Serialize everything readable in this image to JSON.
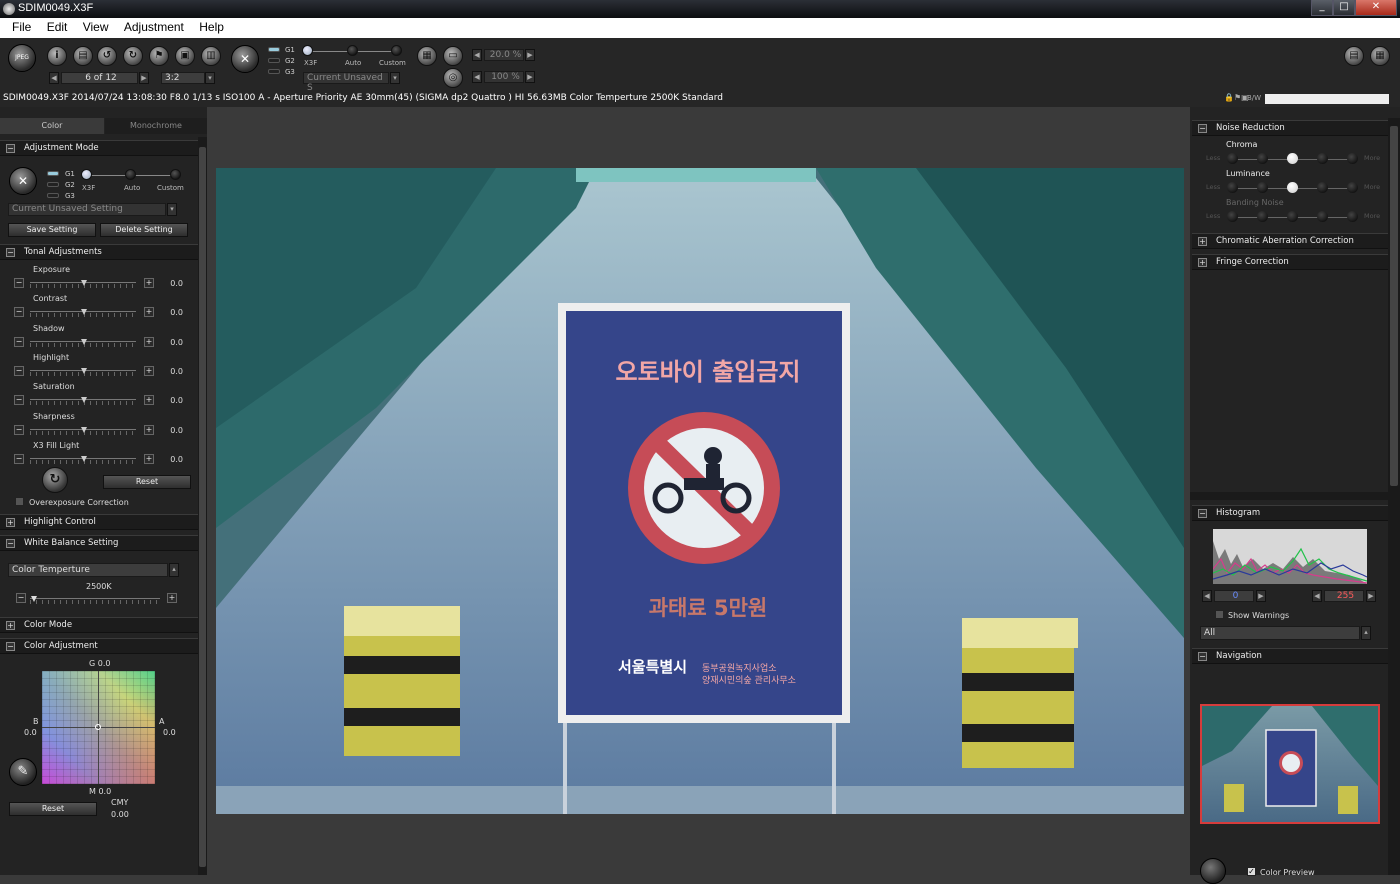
{
  "window": {
    "title": "SDIM0049.X3F",
    "controls": [
      "_",
      "□",
      "✕"
    ]
  },
  "menu": [
    "File",
    "Edit",
    "View",
    "Adjustment",
    "Help"
  ],
  "toolbar": {
    "icons": [
      "jpeg-tiff-icon",
      "info-icon",
      "print-icon",
      "rotate-left-icon",
      "rotate-right-icon",
      "flag-icon",
      "lock-icon",
      "trash-icon"
    ],
    "nav_counter": "6 of 12",
    "ratio": "3:2",
    "mode_labels": {
      "g1": "G1",
      "g2": "G2",
      "g3": "G3",
      "x3f": "X3F",
      "auto": "Auto",
      "custom": "Custom"
    },
    "setting": "Current Unsaved S",
    "zoom_fit": "20.0 %",
    "zoom_full": "100 %"
  },
  "infobar": {
    "text": "SDIM0049.X3F 2014/07/24 13:08:30 F8.0 1/13 s ISO100 A - Aperture Priority AE 30mm(45) (SIGMA dp2 Quattro ) HI 56.63MB Color Temperture 2500K Standard",
    "bw_label": "B/W"
  },
  "left": {
    "tabs": [
      "Color",
      "Monochrome"
    ],
    "adjustment_mode": {
      "title": "Adjustment Mode",
      "g1": "G1",
      "g2": "G2",
      "g3": "G3",
      "x3f": "X3F",
      "auto": "Auto",
      "custom": "Custom",
      "setting": "Current Unsaved Setting",
      "save": "Save Setting",
      "delete": "Delete Setting"
    },
    "tonal": {
      "title": "Tonal Adjustments",
      "items": [
        {
          "label": "Exposure",
          "value": "0.0"
        },
        {
          "label": "Contrast",
          "value": "0.0"
        },
        {
          "label": "Shadow",
          "value": "0.0"
        },
        {
          "label": "Highlight",
          "value": "0.0"
        },
        {
          "label": "Saturation",
          "value": "0.0"
        },
        {
          "label": "Sharpness",
          "value": "0.0"
        },
        {
          "label": "X3 Fill Light",
          "value": "0.0"
        }
      ],
      "reset": "Reset",
      "overexposure": "Overexposure Correction"
    },
    "highlight_control": "Highlight Control",
    "white_balance": {
      "title": "White Balance Setting",
      "mode": "Color Temperture",
      "kelvin": "2500K"
    },
    "color_mode": "Color Mode",
    "color_adjustment": {
      "title": "Color Adjustment",
      "g": "G 0.0",
      "b": "B",
      "b_val": "0.0",
      "a": "A",
      "a_val": "0.0",
      "m": "M 0.0",
      "cmy": "CMY",
      "cmy_val": "0.00",
      "reset": "Reset"
    }
  },
  "photo": {
    "sign_title": "오토바이 출입금지",
    "sign_fine": "과태료 5만원",
    "sign_org": "서울특별시",
    "sign_dept1": "동부공원녹지사업소",
    "sign_dept2": "양재시민의숲 관리사무소"
  },
  "right": {
    "noise": {
      "title": "Noise Reduction",
      "chroma": "Chroma",
      "luminance": "Luminance",
      "banding": "Banding Noise",
      "less": "Less",
      "more": "More"
    },
    "chromatic": "Chromatic Aberration Correction",
    "fringe": "Fringe Correction",
    "histogram": {
      "title": "Histogram",
      "low": "0",
      "high": "255",
      "show_warnings": "Show Warnings",
      "channel": "All"
    },
    "navigation": {
      "title": "Navigation",
      "preview": "Color Preview"
    }
  }
}
